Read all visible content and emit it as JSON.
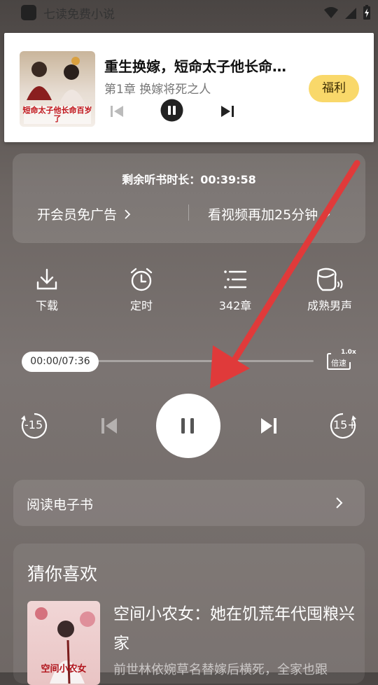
{
  "status_bar": {
    "app_name": "七读免费小说"
  },
  "mini_player": {
    "book_title": "重生换嫁，短命太子他长命…",
    "chapter": "第1章 换嫁将死之人",
    "welfare_label": "福利",
    "cover_text": "短命太子他长命百岁了"
  },
  "vip": {
    "remaining_time": "剩余听书时长：00:39:58",
    "left_link": "开会员免广告",
    "right_link": "看视频再加25分钟"
  },
  "tools": [
    {
      "label": "下载",
      "icon": "download-icon"
    },
    {
      "label": "定时",
      "icon": "alarm-clock-icon"
    },
    {
      "label": "342章",
      "icon": "chapter-list-icon"
    },
    {
      "label": "成熟男声",
      "icon": "voice-icon"
    }
  ],
  "playback": {
    "time": "00:00/07:36",
    "progress": 0,
    "speed_value": "1.0x",
    "speed_label": "倍速",
    "rewind_label": "15",
    "forward_label": "15+"
  },
  "read_ebook": {
    "label": "阅读电子书"
  },
  "recommend": {
    "section_title": "猜你喜欢",
    "book_title": "空间小农女：她在饥荒年代囤粮兴家",
    "book_desc": "前世林依婉草名替嫁后横死，全家也跟",
    "cover_text": "空间小农女"
  },
  "colors": {
    "accent_yellow": "#f9d86a",
    "arrow_red": "#e03a3a"
  }
}
